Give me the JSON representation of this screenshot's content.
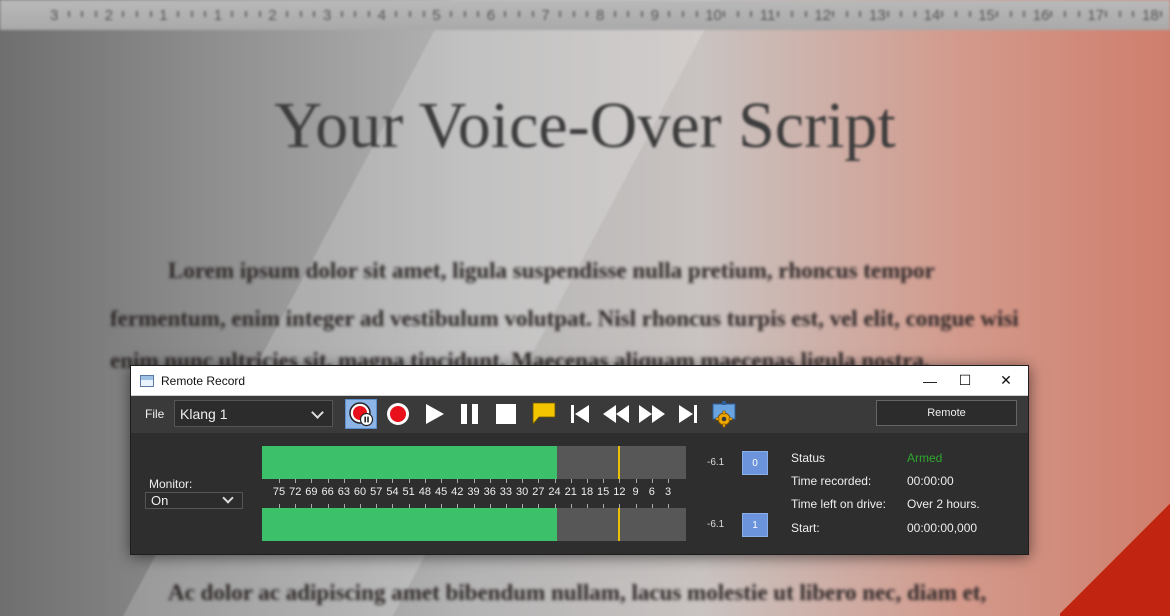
{
  "background": {
    "ruler_numbers": [
      "3",
      "2",
      "1",
      "1",
      "2",
      "3",
      "4",
      "5",
      "6",
      "7",
      "8",
      "9",
      "10",
      "11",
      "12",
      "13",
      "14",
      "15",
      "16",
      "17",
      "18"
    ],
    "doc_title": "Your Voice-Over Script",
    "doc_lines": [
      "Lorem ipsum dolor sit amet, ligula suspendisse nulla pretium, rhoncus tempor",
      "fermentum, enim integer ad vestibulum volutpat. Nisl rhoncus turpis est, vel elit, congue wisi",
      "enim nunc ultricies sit, magna tincidunt. Maecenas aliquam maecenas ligula nostra,",
      "Ac dolor ac adipiscing amet bibendum nullam, lacus molestie ut libero nec, diam et,"
    ]
  },
  "window": {
    "title": "Remote Record",
    "minimize_glyph": "—",
    "maximize_glyph": "☐",
    "close_glyph": "✕"
  },
  "toolbar": {
    "file_label": "File",
    "track_value": "Klang 1",
    "buttons": [
      {
        "name": "record-pause-button",
        "icon": "record-pause-icon",
        "active": true
      },
      {
        "name": "record-button",
        "icon": "record-icon",
        "active": false
      },
      {
        "name": "play-button",
        "icon": "play-icon",
        "active": false
      },
      {
        "name": "pause-button",
        "icon": "pause-icon",
        "active": false
      },
      {
        "name": "stop-button",
        "icon": "stop-icon",
        "active": false
      },
      {
        "name": "marker-button",
        "icon": "marker-flag-icon",
        "active": false
      },
      {
        "name": "go-to-start-button",
        "icon": "skip-back-icon",
        "active": false
      },
      {
        "name": "rewind-button",
        "icon": "rewind-icon",
        "active": false
      },
      {
        "name": "fast-forward-button",
        "icon": "fast-forward-icon",
        "active": false
      },
      {
        "name": "go-to-end-button",
        "icon": "skip-forward-icon",
        "active": false
      },
      {
        "name": "settings-button",
        "icon": "settings-gear-icon",
        "active": false
      }
    ],
    "remote_label": "Remote"
  },
  "monitor": {
    "label": "Monitor:",
    "value": "On"
  },
  "meters": {
    "scale_labels": [
      "75",
      "72",
      "69",
      "66",
      "63",
      "60",
      "57",
      "54",
      "51",
      "48",
      "45",
      "42",
      "39",
      "36",
      "33",
      "30",
      "27",
      "24",
      "21",
      "18",
      "15",
      "12",
      "9",
      "6",
      "3"
    ],
    "channels": [
      {
        "level_db": "-6.1",
        "channel_label": "0",
        "fill_fraction": 0.696,
        "peak_fraction": 0.84
      },
      {
        "level_db": "-6.1",
        "channel_label": "1",
        "fill_fraction": 0.696,
        "peak_fraction": 0.84
      }
    ],
    "colors": {
      "level": "#3cc06a",
      "peak": "#e8c000",
      "track": "#575757"
    }
  },
  "status": {
    "rows": [
      {
        "label": "Status",
        "value": "Armed",
        "armed": true
      },
      {
        "label": "Time recorded:",
        "value": "00:00:00",
        "armed": false
      },
      {
        "label": "Time left on drive:",
        "value": "Over 2 hours.",
        "armed": false
      },
      {
        "label": "Start:",
        "value": "00:00:00,000",
        "armed": false
      }
    ],
    "armed_color": "#2ea82e"
  }
}
